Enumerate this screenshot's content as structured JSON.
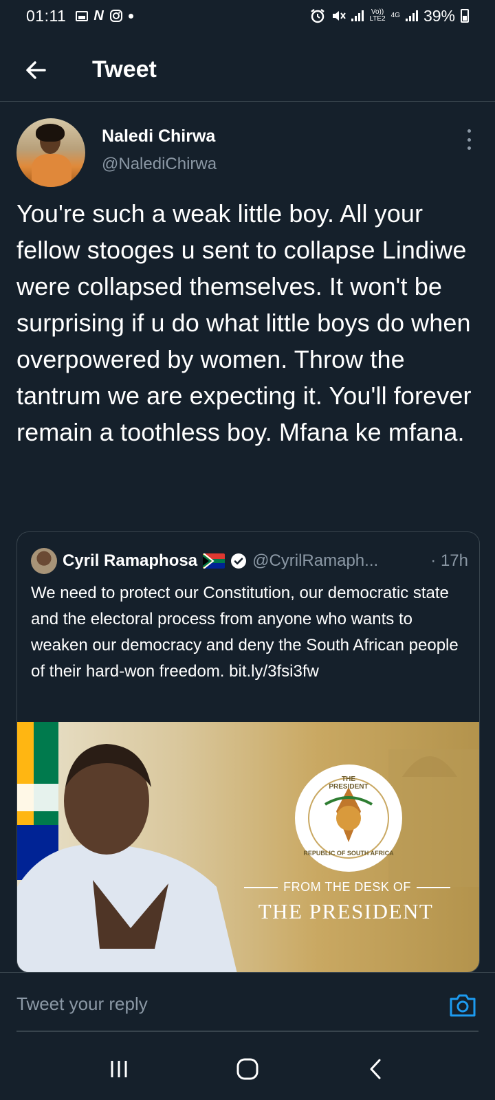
{
  "status_bar": {
    "time": "01:11",
    "battery": "39%",
    "network_top": "Vo))",
    "network_bottom": "LTE2",
    "network_type": "4G"
  },
  "header": {
    "title": "Tweet",
    "back_icon": "arrow-left-icon"
  },
  "tweet": {
    "author_name": "Naledi Chirwa",
    "author_handle": "@NalediChirwa",
    "text": "You're such a weak little boy. All your fellow stooges u sent to collapse Lindiwe were collapsed themselves. It won't be surprising if u do what little boys do when overpowered by women. Throw the tantrum we are expecting it. You'll forever remain a toothless boy. Mfana ke mfana."
  },
  "quoted_tweet": {
    "author_name": "Cyril Ramaphosa",
    "author_handle": "@CyrilRamaph...",
    "time": "· 17h",
    "text": "We need to protect our Constitution, our democratic state and the electoral process from anyone who wants to weaken our democracy and deny the South African people of their hard-won freedom. bit.ly/3fsi3fw",
    "image": {
      "seal_top_text": "THE PRESIDENT",
      "seal_bottom_text": "REPUBLIC OF SOUTH AFRICA",
      "caption_small": "FROM THE DESK OF",
      "caption_large": "THE PRESIDENT"
    }
  },
  "reply": {
    "placeholder": "Tweet your reply",
    "camera_icon": "camera-icon"
  },
  "colors": {
    "background": "#15202b",
    "border": "#38444d",
    "muted_text": "#8b98a5",
    "accent": "#1d9bf0"
  }
}
